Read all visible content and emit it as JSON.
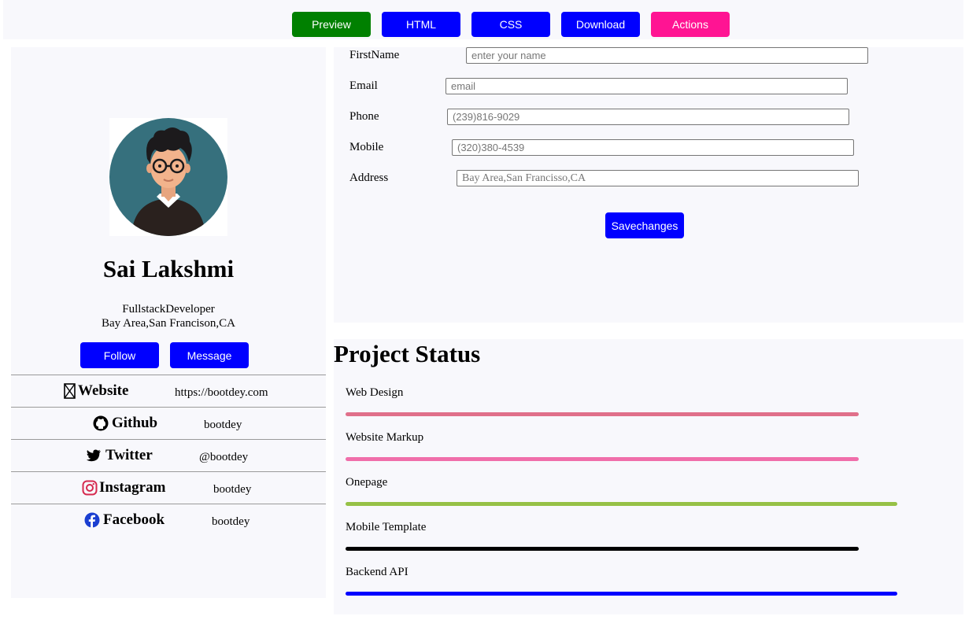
{
  "toolbar": {
    "buttons": [
      {
        "label": "Preview",
        "color": "#008000"
      },
      {
        "label": "HTML",
        "color": "#0000ff"
      },
      {
        "label": "CSS",
        "color": "#0000ff"
      },
      {
        "label": "Download",
        "color": "#0000ff"
      },
      {
        "label": "Actions",
        "color": "#ff1493"
      }
    ]
  },
  "profile": {
    "name": "Sai Lakshmi",
    "role": "FullstackDeveloper",
    "location": "Bay Area,San Francison,CA",
    "follow_label": "Follow",
    "message_label": "Message"
  },
  "social": [
    {
      "label": "Website",
      "value": "https://bootdey.com",
      "icon": "globe-icon"
    },
    {
      "label": "Github",
      "value": "bootdey",
      "icon": "github-icon"
    },
    {
      "label": "Twitter",
      "value": "@bootdey",
      "icon": "twitter-icon"
    },
    {
      "label": "Instagram",
      "value": "bootdey",
      "icon": "instagram-icon"
    },
    {
      "label": "Facebook",
      "value": "bootdey",
      "icon": "facebook-icon"
    }
  ],
  "form": {
    "firstname_label": "FirstName",
    "firstname_placeholder": "enter your name",
    "email_label": "Email",
    "email_placeholder": "email",
    "phone_label": "Phone",
    "phone_placeholder": "(239)816-9029",
    "mobile_label": "Mobile",
    "mobile_placeholder": "(320)380-4539",
    "address_label": "Address",
    "address_placeholder": "Bay Area,San Francisso,CA",
    "save_label": "Savechanges"
  },
  "project_status": {
    "title": "Project Status",
    "items": [
      {
        "label": "Web Design",
        "progress": 0.93,
        "color": "#e0708a"
      },
      {
        "label": "Website Markup",
        "progress": 0.93,
        "color": "#f06eaa"
      },
      {
        "label": "Onepage",
        "progress": 1.0,
        "color": "#96c146"
      },
      {
        "label": "Mobile Template",
        "progress": 0.93,
        "color": "#000000"
      },
      {
        "label": "Backend API",
        "progress": 1.0,
        "color": "#0000ff"
      }
    ]
  }
}
